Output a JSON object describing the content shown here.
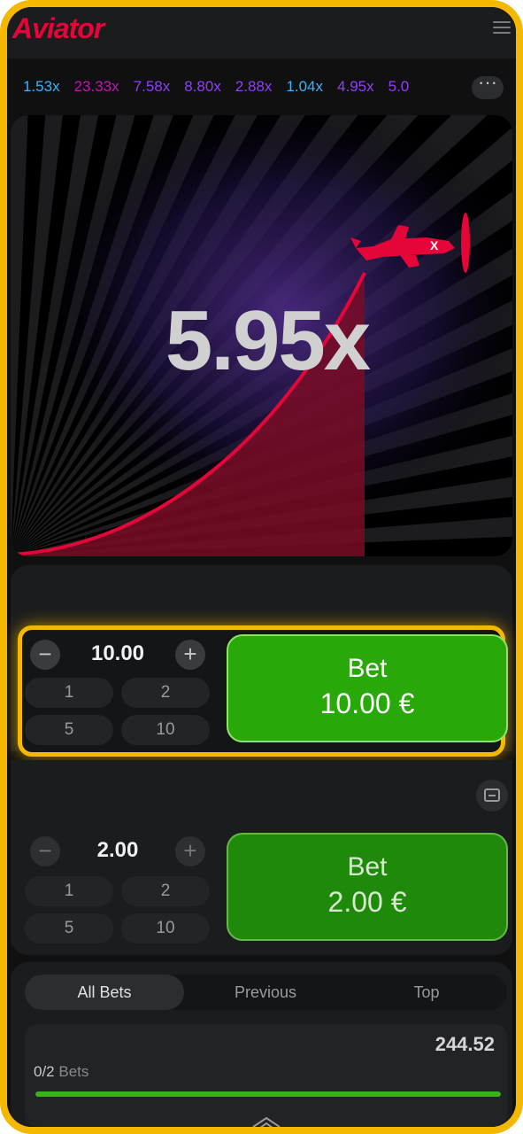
{
  "app": {
    "logo": "Aviator"
  },
  "history": {
    "items": [
      {
        "value": "1.53x",
        "color": "#34b4ff"
      },
      {
        "value": "23.33x",
        "color": "#c017b4"
      },
      {
        "value": "7.58x",
        "color": "#913ef8"
      },
      {
        "value": "8.80x",
        "color": "#913ef8"
      },
      {
        "value": "2.88x",
        "color": "#913ef8"
      },
      {
        "value": "1.04x",
        "color": "#34b4ff"
      },
      {
        "value": "4.95x",
        "color": "#913ef8"
      },
      {
        "value": "5.0",
        "color": "#913ef8"
      }
    ],
    "more_icon": "ellipsis-icon"
  },
  "game": {
    "multiplier": "5.95x",
    "curve_color": "#e50539",
    "plane_color": "#e50539"
  },
  "bet1": {
    "amount": "10.00",
    "quick": [
      "1",
      "2",
      "5",
      "10"
    ],
    "button_label": "Bet",
    "button_amount": "10.00 €",
    "button_color": "#28a909"
  },
  "bet2": {
    "amount": "2.00",
    "quick": [
      "1",
      "2",
      "5",
      "10"
    ],
    "button_label": "Bet",
    "button_amount": "2.00 €",
    "button_color": "#1f8a0a"
  },
  "tabs": [
    "All Bets",
    "Previous",
    "Top"
  ],
  "stats": {
    "amount": "244.52",
    "count": "0/2",
    "count_label": "Bets",
    "progress": 1.0
  }
}
